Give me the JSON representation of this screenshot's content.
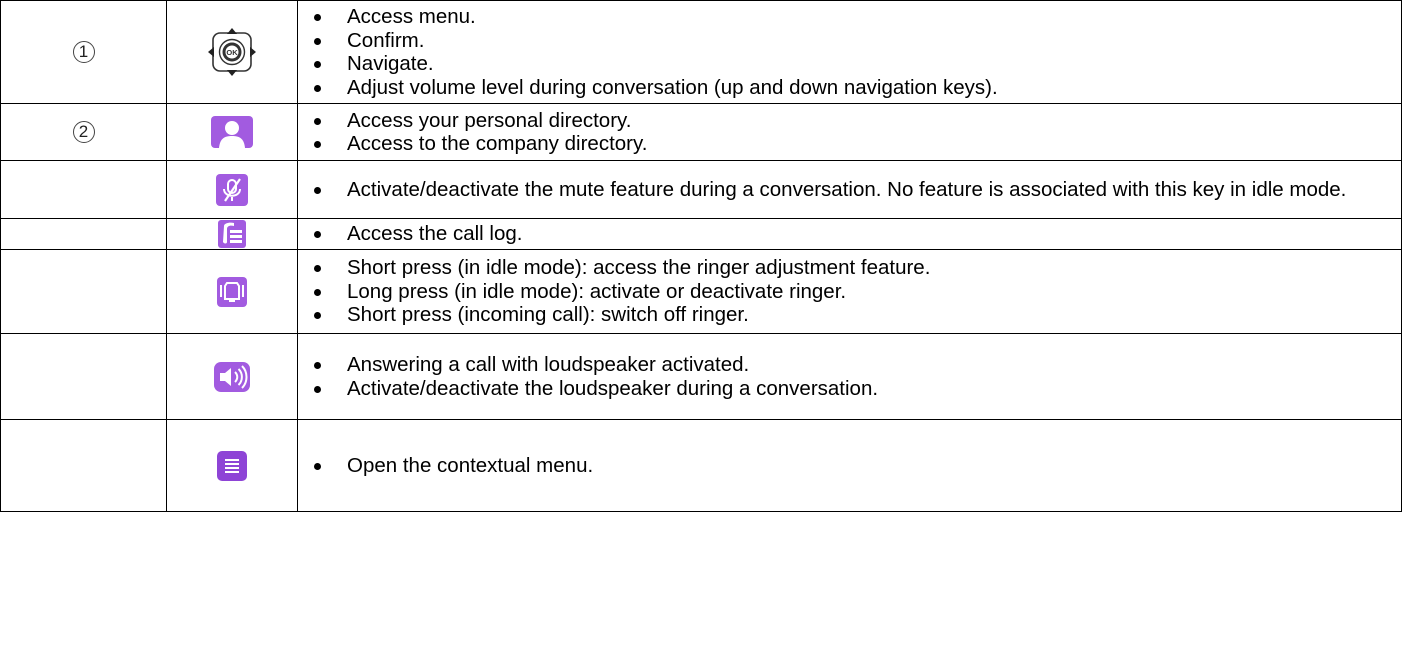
{
  "rows": [
    {
      "number": "1",
      "icon": "navigation-ok-key-icon",
      "items": [
        "Access menu.",
        "Confirm.",
        "Navigate.",
        "Adjust volume level during conversation (up and down navigation keys)."
      ]
    },
    {
      "number": "2",
      "icon": "directory-key-icon",
      "items": [
        "Access your personal directory.",
        "Access to the company directory."
      ]
    },
    {
      "number": "",
      "icon": "mute-key-icon",
      "items": [
        "Activate/deactivate the mute feature during a conversation. No feature is associated with this key in idle mode."
      ]
    },
    {
      "number": "",
      "icon": "call-log-key-icon",
      "items": [
        "Access the call log."
      ]
    },
    {
      "number": "",
      "icon": "ringer-key-icon",
      "items": [
        "Short press (in idle mode): access the ringer adjustment feature.",
        "Long press (in idle mode): activate or deactivate ringer.",
        "Short press (incoming call): switch off ringer."
      ]
    },
    {
      "number": "",
      "icon": "loudspeaker-key-icon",
      "items": [
        "Answering a call with loudspeaker activated.",
        "Activate/deactivate the loudspeaker during a conversation."
      ]
    },
    {
      "number": "",
      "icon": "contextual-menu-key-icon",
      "items": [
        "Open the contextual menu."
      ]
    }
  ],
  "colors": {
    "key_purple": "#a25be0",
    "key_purple_dark": "#8e44d6",
    "border": "#000000"
  }
}
